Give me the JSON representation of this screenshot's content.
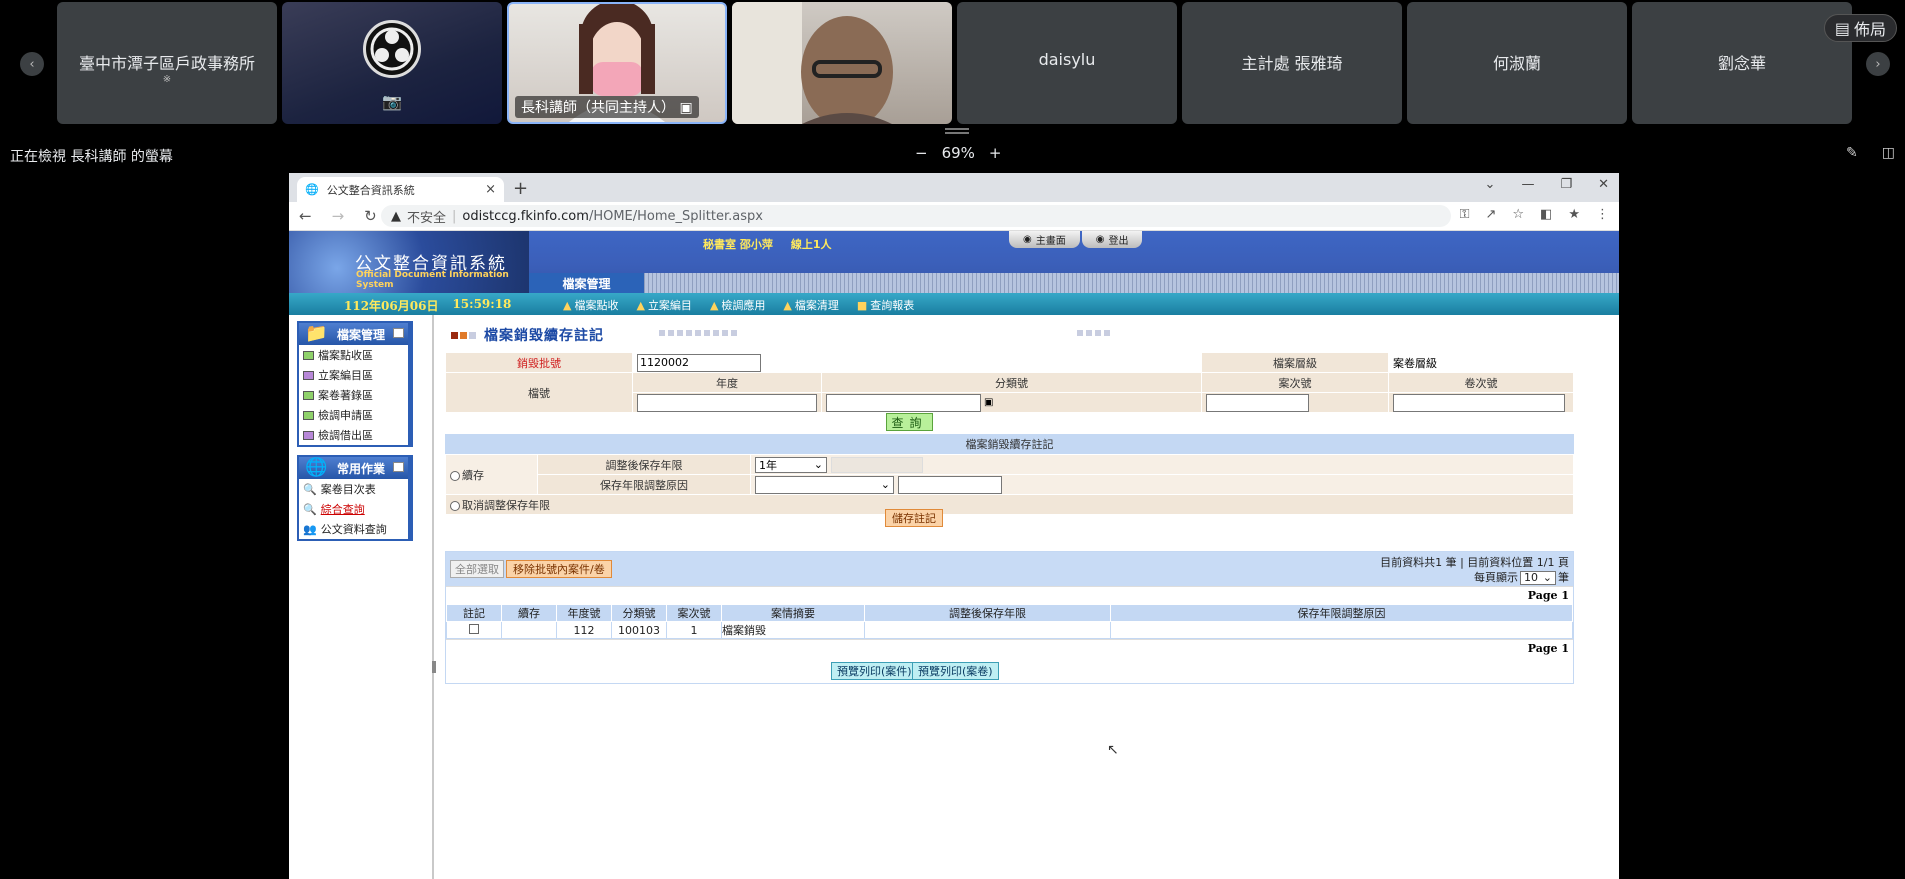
{
  "meeting": {
    "tiles": [
      {
        "name": "臺中市潭子區戶政事務所",
        "sub": "※"
      },
      {
        "name": "",
        "sub": ""
      },
      {
        "name": "長科講師（共同主持人）",
        "sub": ""
      },
      {
        "name": "",
        "sub": ""
      },
      {
        "name": "daisylu",
        "sub": ""
      },
      {
        "name": "主計處 張雅琦",
        "sub": ""
      },
      {
        "name": "何淑蘭",
        "sub": ""
      },
      {
        "name": "劉念華",
        "sub": ""
      }
    ],
    "layout_label": "佈局",
    "viewing_text": "正在檢視 長科講師 的螢幕",
    "zoom": "69%",
    "zoom_minus": "−",
    "zoom_plus": "+"
  },
  "browser": {
    "tab_title": "公文整合資訊系統",
    "tab_close": "×",
    "new_tab": "+",
    "insecure_label": "不安全",
    "url_host": "odistccg.fkinfo.com",
    "url_path": "/HOME/Home_Splitter.aspx"
  },
  "header": {
    "system_title": "公文整合資訊系統",
    "system_subtitle": "Official Document Information System",
    "user": "秘書室 邵小萍",
    "online": "線上1人",
    "btn_home": "主畫面",
    "btn_logout": "登出",
    "module": "檔案管理",
    "date": "112年06月06日",
    "time": "15:59:18",
    "submenu": [
      "檔案點收",
      "立案編目",
      "檢調應用",
      "檔案清理",
      "查詢報表"
    ]
  },
  "sidebar": {
    "panel1_title": "檔案管理",
    "panel1_items": [
      "檔案點收區",
      "立案編目區",
      "案卷著錄區",
      "檢調申請區",
      "檢調借出區"
    ],
    "panel2_title": "常用作業",
    "panel2_items": [
      "案卷目次表",
      "綜合查詢",
      "公文資料查詢"
    ]
  },
  "main": {
    "title": "檔案銷毀續存註記",
    "label_batch": "銷毀批號",
    "batch_value": "1120002",
    "label_level": "檔案層級",
    "level_value": "案卷層級",
    "label_fileno": "檔號",
    "col_year": "年度",
    "col_class": "分類號",
    "col_case": "案次號",
    "col_volume": "卷次號",
    "btn_query": "查詢",
    "section_title": "檔案銷毀續存註記",
    "radio_keep": "續存",
    "label_new_period": "調整後保存年限",
    "period_value": "1年",
    "label_reason": "保存年限調整原因",
    "radio_cancel": "取消調整保存年限",
    "btn_save": "儲存註記",
    "btn_select_all": "全部選取",
    "btn_remove": "移除批號內案件/卷",
    "page_info": "目前資料共1 筆 | 目前資料位置 1/1 頁",
    "per_page_label": "每頁顯示",
    "per_page_value": "10",
    "per_page_unit": "筆",
    "page_label": "Page 1",
    "grid_headers": [
      "註記",
      "續存",
      "年度號",
      "分類號",
      "案次號",
      "案情摘要",
      "調整後保存年限",
      "保存年限調整原因"
    ],
    "grid_rows": [
      {
        "year": "112",
        "class": "100103",
        "case": "1",
        "summary": "檔案銷毀",
        "period": "",
        "reason": ""
      }
    ],
    "btn_preview_case": "預覽列印(案件)",
    "btn_preview_volume": "預覽列印(案卷)"
  }
}
